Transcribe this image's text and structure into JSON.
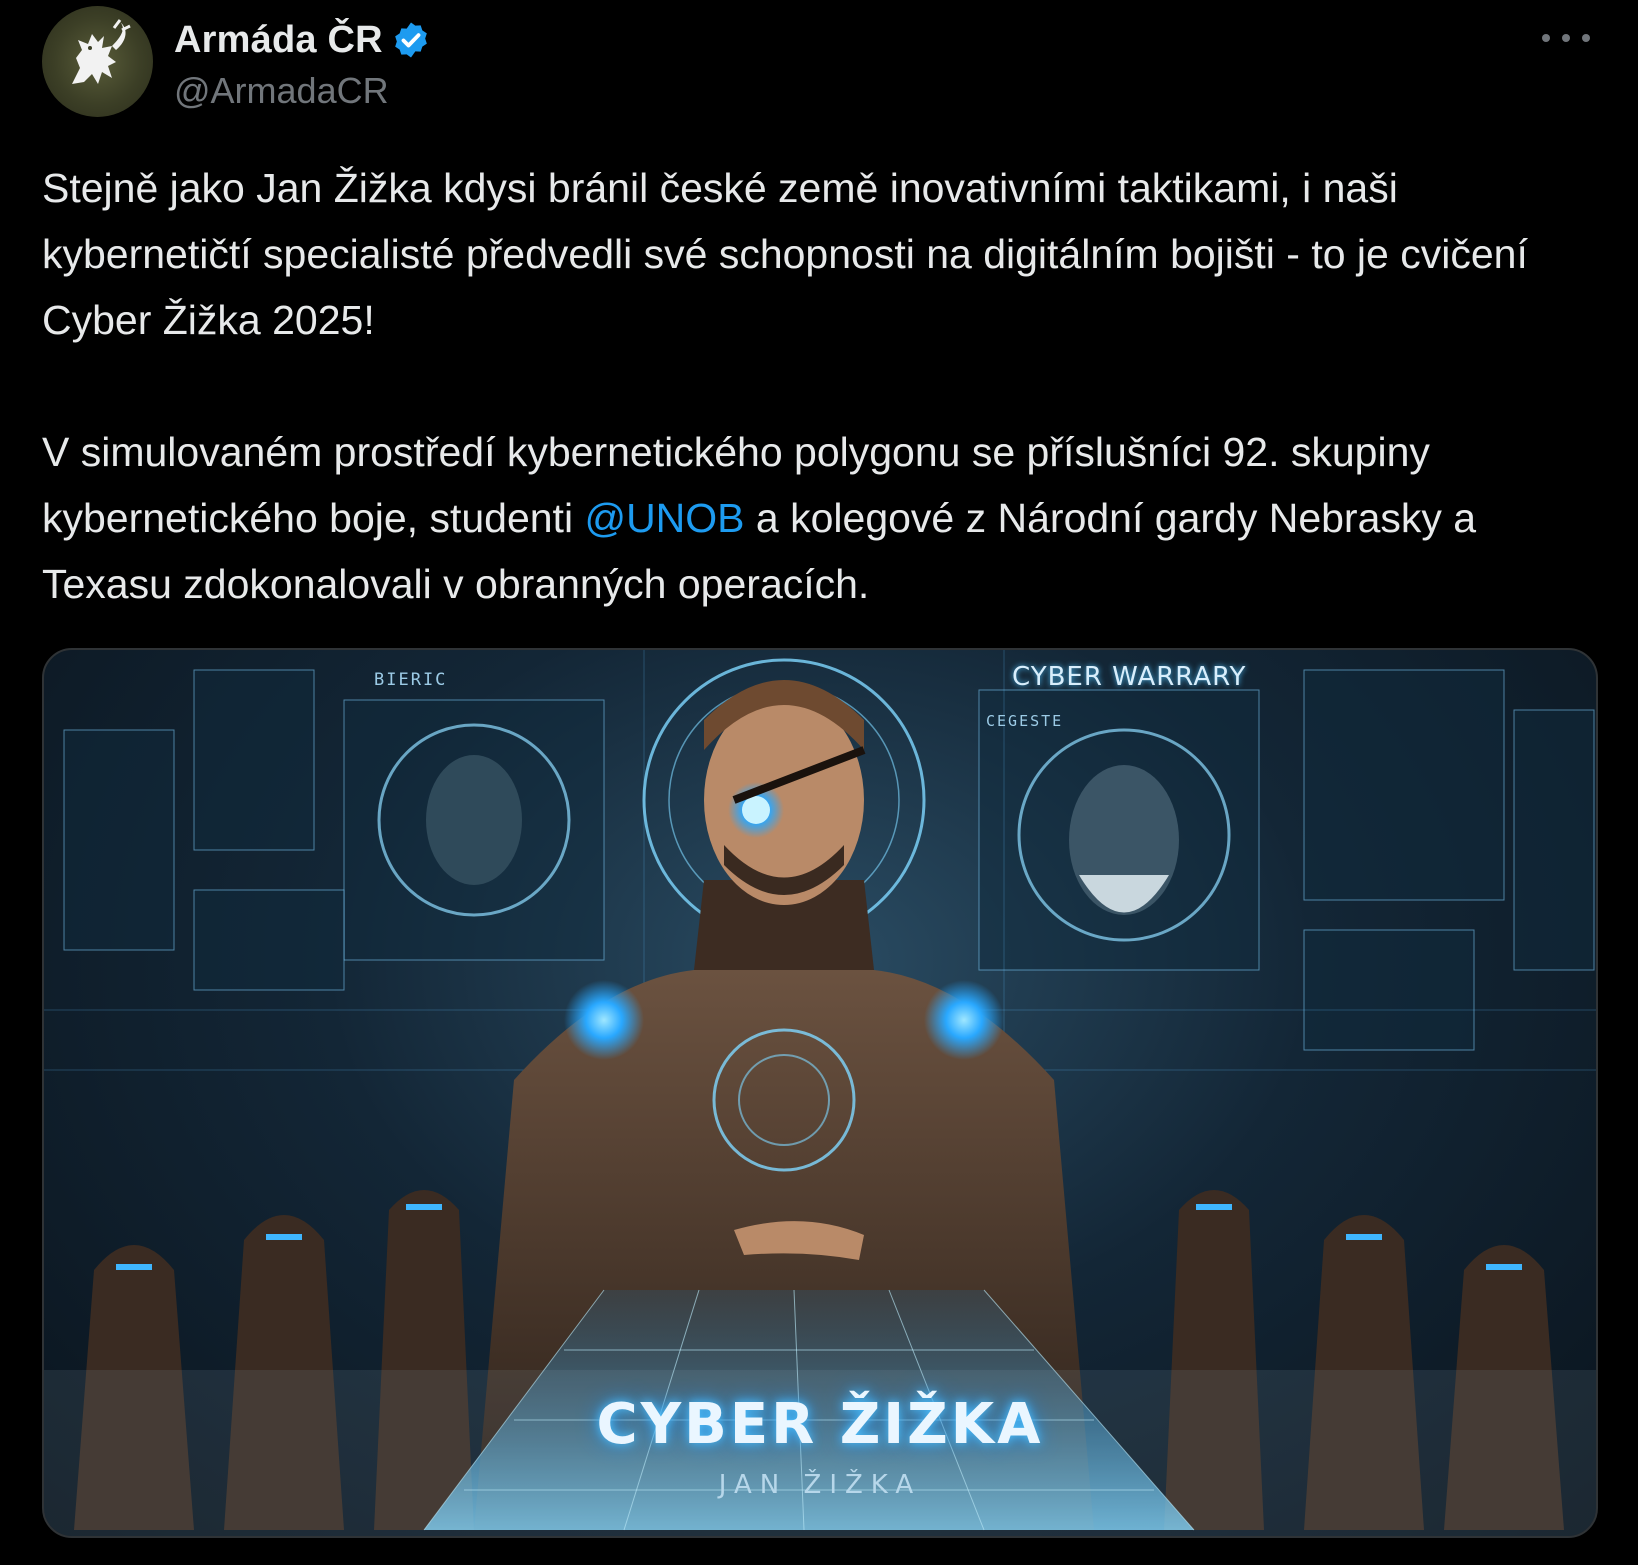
{
  "post": {
    "author": {
      "display_name": "Armáda ČR",
      "handle": "@ArmadaCR",
      "verified": true,
      "avatar_icon": "czech-lion-emblem"
    },
    "menu_icon": "more-dots-icon",
    "text_paragraphs": [
      "Stejně jako Jan Žižka kdysi bránil české země inovativními taktikami, i naši kybernetičtí specialisté předvedli své schopnosti na digitálním bojišti - to je cvičení Cyber Žižka 2025!",
      ""
    ],
    "p2_before": "V simulovaném prostředí kybernetického polygonu se příslušníci 92. skupiny kybernetického boje, studenti ",
    "mention": "@UNOB",
    "p2_after": " a kolegové z Národní gardy Nebrasky a Texasu zdokonalovali v obranných operacích.",
    "image": {
      "title": "CYBER ŽIŽKA",
      "subtitle": "JAN ŽIŽKA",
      "panel_label_right": "CYBER WARRARY",
      "panel_label_left": "BIERIC",
      "panel_label_small": "CEGESTE"
    },
    "colors": {
      "background": "#000000",
      "text": "#e7e9ea",
      "secondary": "#71767b",
      "link": "#1d9bf0",
      "verified_badge": "#1d9bf0"
    }
  }
}
